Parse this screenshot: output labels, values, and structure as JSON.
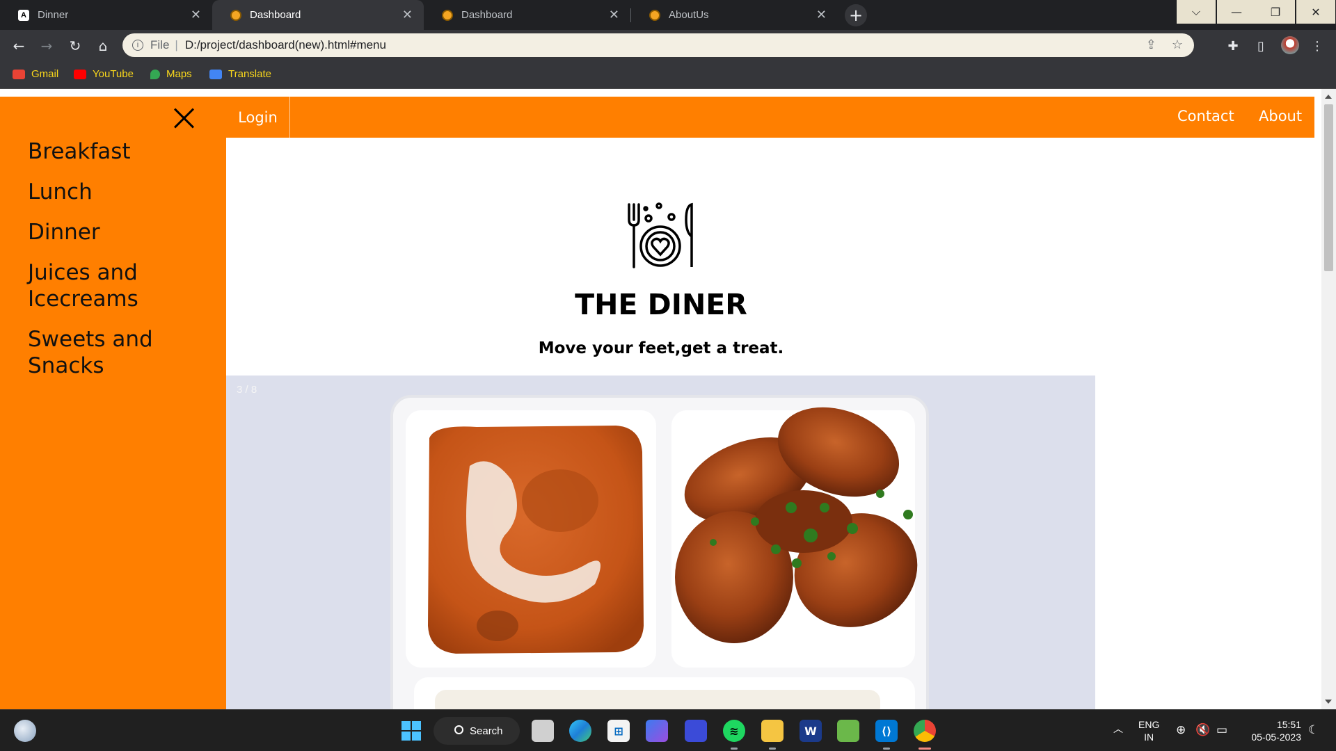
{
  "browser": {
    "tabs": [
      {
        "title": "Dinner",
        "favicon": "angular-icon",
        "active": false
      },
      {
        "title": "Dashboard",
        "favicon": "diner-icon",
        "active": true
      },
      {
        "title": "Dashboard",
        "favicon": "diner-icon",
        "active": false
      },
      {
        "title": "AboutUs",
        "favicon": "diner-icon",
        "active": false
      }
    ],
    "address": {
      "scheme_label": "File",
      "url": "D:/project/dashboard(new).html#menu"
    },
    "bookmarks": [
      {
        "label": "Gmail",
        "color": "#ea4335"
      },
      {
        "label": "YouTube",
        "color": "#ff0000"
      },
      {
        "label": "Maps",
        "color": "#34a853"
      },
      {
        "label": "Translate",
        "color": "#4285f4"
      }
    ]
  },
  "page": {
    "accent_color": "#ff7f00",
    "sidebar": {
      "items": [
        {
          "label": "Breakfast"
        },
        {
          "label": "Lunch"
        },
        {
          "label": "Dinner"
        },
        {
          "label": "Juices and Icecreams"
        },
        {
          "label": "Sweets and Snacks"
        }
      ]
    },
    "topnav": {
      "login": "Login",
      "contact": "Contact",
      "about": "About"
    },
    "hero": {
      "title": "THE DINER",
      "tagline": "Move your feet,get a treat."
    },
    "slideshow": {
      "counter": "3 / 8",
      "image": "butter-chicken-and-tandoori-wings-plate"
    }
  },
  "taskbar": {
    "search_label": "Search",
    "language_line1": "ENG",
    "language_line2": "IN",
    "time": "15:51",
    "date": "05-05-2023"
  }
}
